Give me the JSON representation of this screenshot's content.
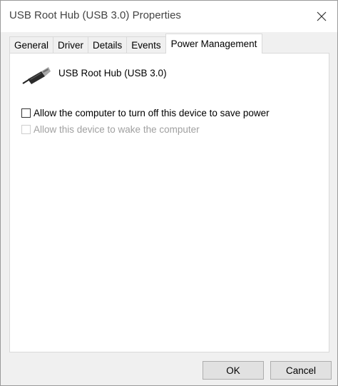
{
  "window": {
    "title": "USB Root Hub (USB 3.0) Properties"
  },
  "tabs": [
    {
      "label": "General",
      "active": false
    },
    {
      "label": "Driver",
      "active": false
    },
    {
      "label": "Details",
      "active": false
    },
    {
      "label": "Events",
      "active": false
    },
    {
      "label": "Power Management",
      "active": true
    }
  ],
  "device": {
    "name": "USB Root Hub (USB 3.0)",
    "icon": "usb-connector-icon"
  },
  "options": [
    {
      "label": "Allow the computer to turn off this device to save power",
      "checked": false,
      "enabled": true
    },
    {
      "label": "Allow this device to wake the computer",
      "checked": false,
      "enabled": false
    }
  ],
  "buttons": {
    "ok": "OK",
    "cancel": "Cancel"
  },
  "colors": {
    "window_bg": "#f0f0f0",
    "panel_bg": "#ffffff",
    "disabled_text": "#a0a0a0",
    "button_bg": "#e1e1e1"
  }
}
